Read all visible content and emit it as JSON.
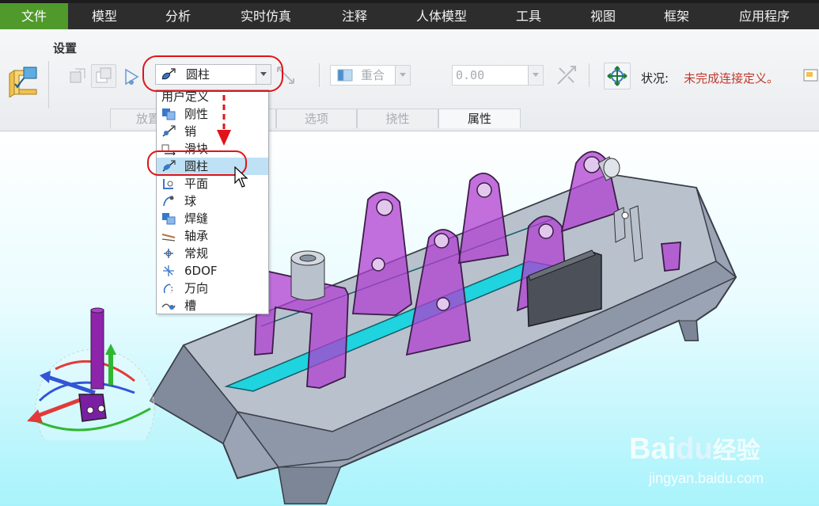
{
  "menu": {
    "items": [
      {
        "label": "文件",
        "active": true
      },
      {
        "label": "模型"
      },
      {
        "label": "分析"
      },
      {
        "label": "实时仿真"
      },
      {
        "label": "注释"
      },
      {
        "label": "人体模型"
      },
      {
        "label": "工具"
      },
      {
        "label": "视图"
      },
      {
        "label": "框架"
      },
      {
        "label": "应用程序"
      }
    ]
  },
  "ribbon": {
    "group_title": "设置",
    "connection_type": {
      "value": "圆柱",
      "icon": "cylinder-joint-icon"
    },
    "constraint_type": {
      "value": "重合",
      "icon": "coincident-icon",
      "disabled": true
    },
    "offset": {
      "value": "0.00",
      "disabled": true
    },
    "status": {
      "label": "状况:",
      "value": "未完成连接定义。",
      "value_color": "#c0392b"
    }
  },
  "tabs": [
    {
      "label": "放置",
      "partially_hidden": true,
      "visible_text": "放置"
    },
    {
      "label": "选项",
      "disabled": true
    },
    {
      "label": "挠性",
      "disabled": true
    },
    {
      "label": "属性",
      "disabled": false
    }
  ],
  "dropdown": {
    "header": "用户定义",
    "options": [
      {
        "label": "刚性",
        "icon": "rigid-icon"
      },
      {
        "label": "销",
        "icon": "pin-icon"
      },
      {
        "label": "滑块",
        "icon": "slider-icon"
      },
      {
        "label": "圆柱",
        "icon": "cylinder-icon",
        "selected": true
      },
      {
        "label": "平面",
        "icon": "planar-icon"
      },
      {
        "label": "球",
        "icon": "ball-icon"
      },
      {
        "label": "焊缝",
        "icon": "weld-icon"
      },
      {
        "label": "轴承",
        "icon": "bearing-icon"
      },
      {
        "label": "常规",
        "icon": "general-icon"
      },
      {
        "label": "6DOF",
        "icon": "6dof-icon"
      },
      {
        "label": "万向",
        "icon": "gimbal-icon"
      },
      {
        "label": "槽",
        "icon": "slot-icon"
      }
    ]
  },
  "watermark": {
    "brand": "Bai",
    "brand2": "du",
    "brand3": "经验",
    "url": "jingyan.baidu.com"
  },
  "colors": {
    "accent": "#4f9a2a",
    "menu_bg": "#2d2d2d",
    "annotation_red": "#e0141a",
    "part_purple": "#b03fd0",
    "slot_cyan": "#1fd3df"
  }
}
